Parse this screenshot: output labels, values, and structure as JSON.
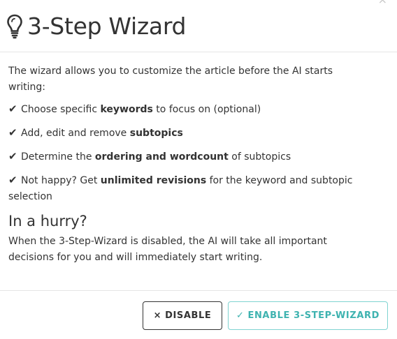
{
  "dialog": {
    "title": "3-Step Wizard",
    "close_symbol": "×",
    "title_icon": "lightbulb-icon"
  },
  "body": {
    "intro": "The wizard allows you to customize the article before the AI starts writing:",
    "check_symbol": "✔",
    "features": [
      {
        "before": "Choose specific ",
        "bold": "keywords",
        "after": " to focus on (optional)"
      },
      {
        "before": "Add, edit and remove ",
        "bold": "subtopics",
        "after": ""
      },
      {
        "before": "Determine the ",
        "bold": "ordering and wordcount",
        "after": " of subtopics"
      },
      {
        "before": "Not happy? Get ",
        "bold": "unlimited revisions",
        "after": " for the keyword and subtopic selection"
      }
    ],
    "hurry_title": "In a hurry?",
    "hurry_text": "When the 3-Step-Wizard is disabled, the AI will take all important decisions for you and will immediately start writing."
  },
  "footer": {
    "disable_symbol": "×",
    "disable_label": "DISABLE",
    "enable_symbol": "✓",
    "enable_label": "ENABLE 3-STEP-WIZARD"
  },
  "colors": {
    "enable_border": "#7fd3d1",
    "enable_text": "#3fb3b0",
    "text": "#333333"
  }
}
